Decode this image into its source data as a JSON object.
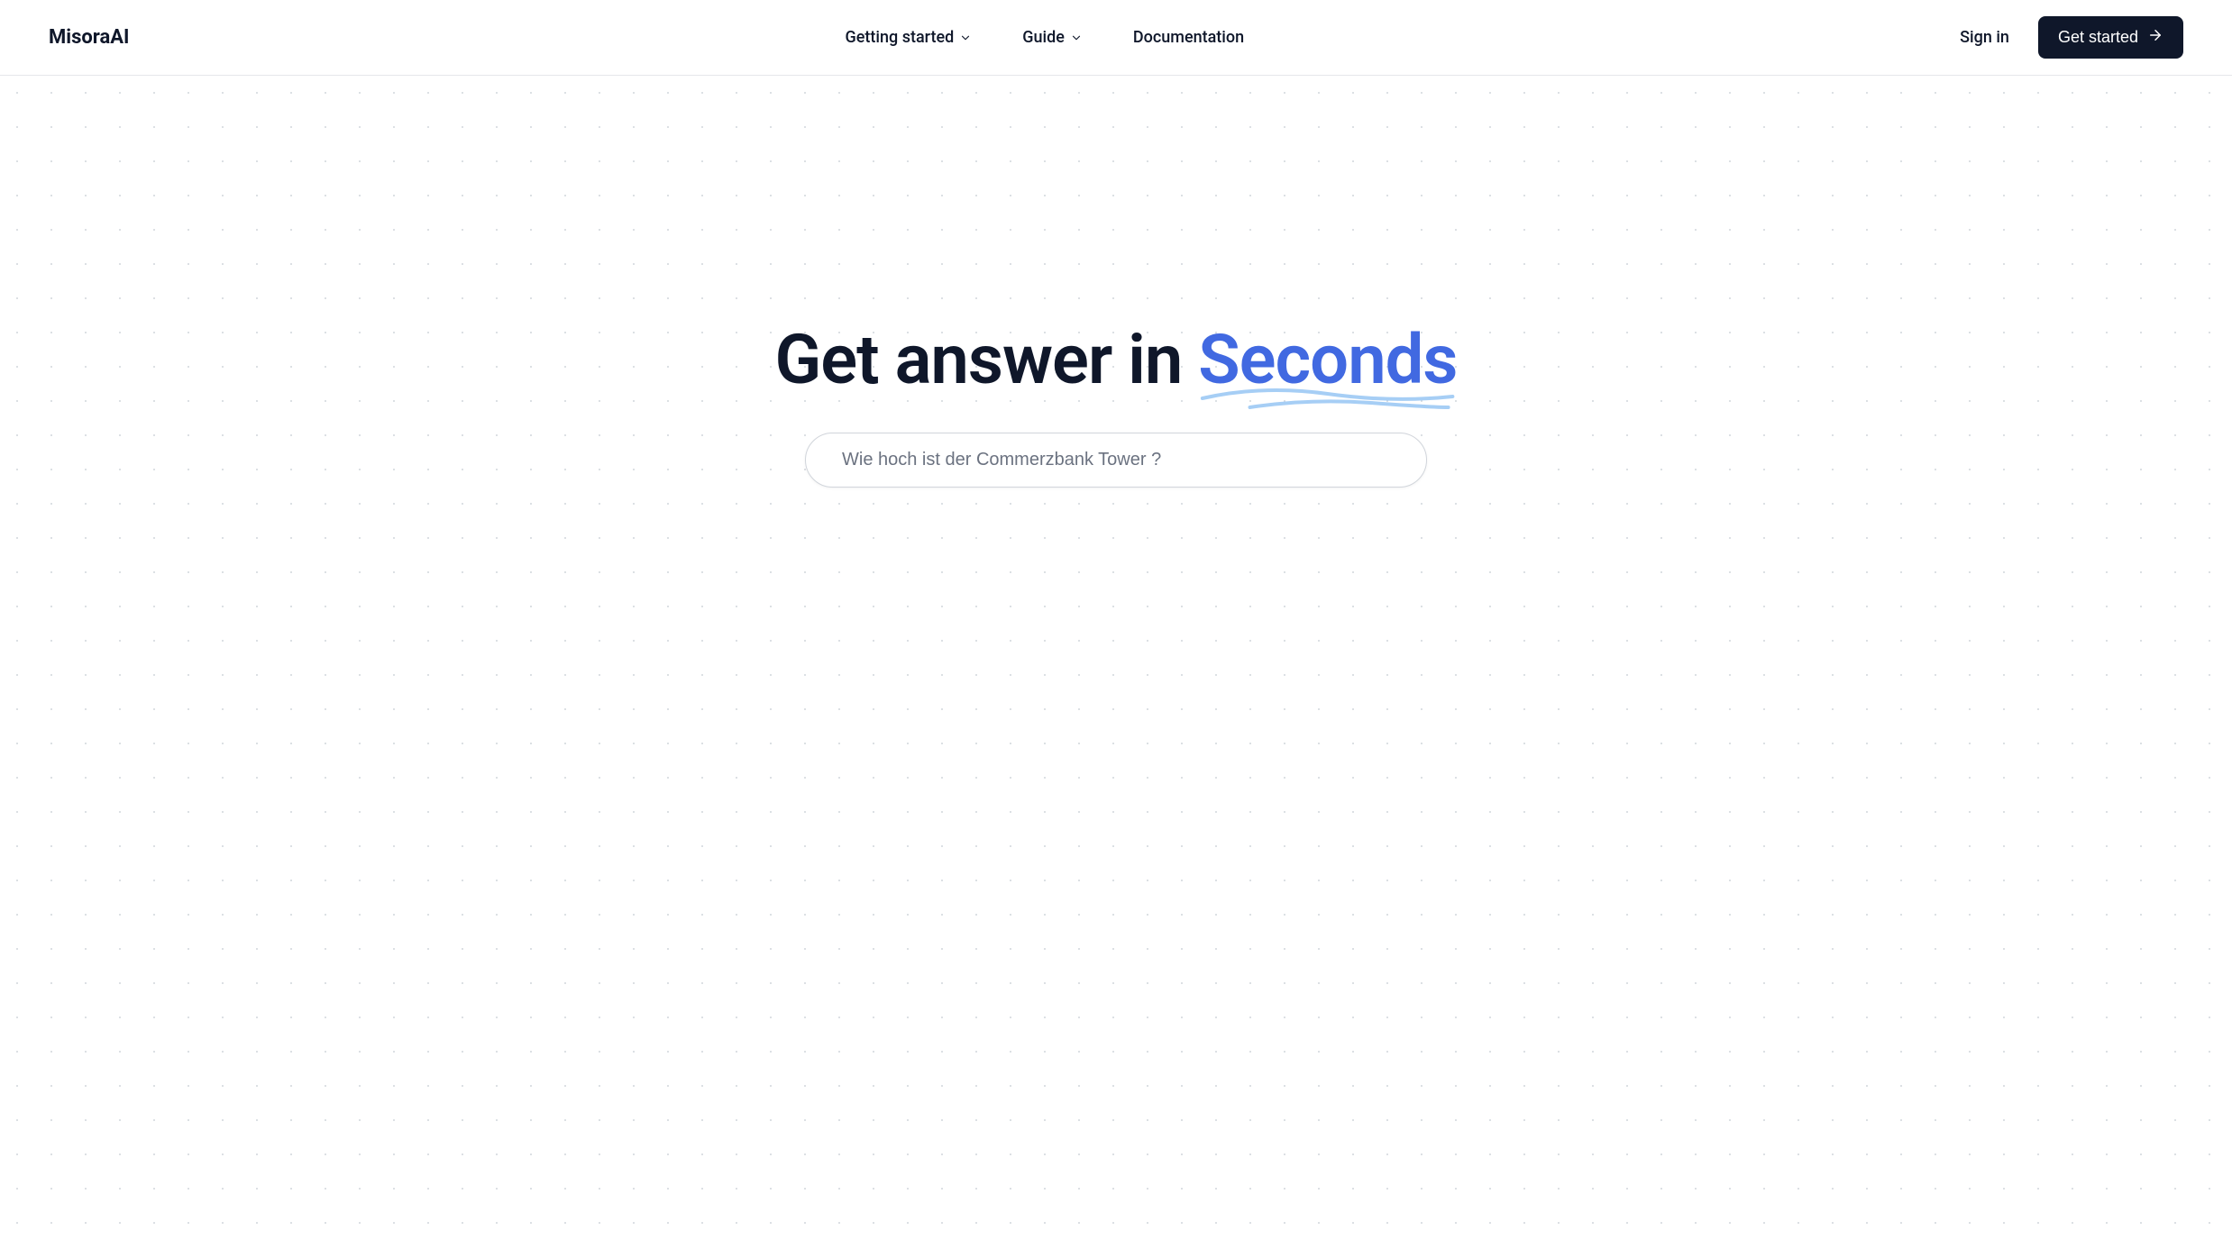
{
  "header": {
    "logo": "MisoraAI",
    "nav": {
      "items": [
        {
          "label": "Getting started",
          "hasDropdown": true
        },
        {
          "label": "Guide",
          "hasDropdown": true
        },
        {
          "label": "Documentation",
          "hasDropdown": false
        }
      ]
    },
    "signIn": "Sign in",
    "getStarted": "Get started"
  },
  "hero": {
    "titlePrefix": "Get answer in ",
    "titleAccent": "Seconds",
    "searchPlaceholder": "Wie hoch ist der Commerzbank Tower ?"
  },
  "colors": {
    "primary": "#0f172a",
    "accent": "#4169e1",
    "squiggle": "#a6cef5",
    "border": "#d1d5db",
    "placeholder": "#6b7280"
  }
}
